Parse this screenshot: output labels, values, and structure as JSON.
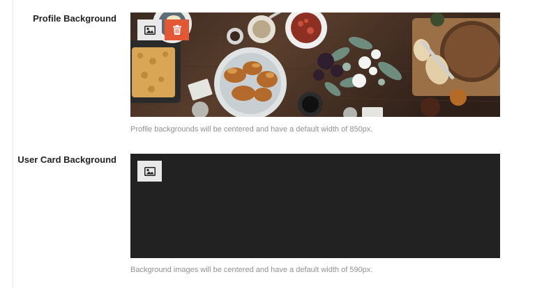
{
  "profile_background": {
    "label": "Profile Background",
    "help_text": "Profile backgrounds will be centered and have a default width of 850px.",
    "upload_icon": "image-icon",
    "delete_icon": "trash-icon"
  },
  "user_card_background": {
    "label": "User Card Background",
    "help_text": "Background images will be centered and have a default width of 590px.",
    "upload_icon": "image-icon"
  },
  "colors": {
    "delete_button": "#e45735",
    "upload_button": "#e9e9e9",
    "card_placeholder": "#222222",
    "help_text": "#919191"
  }
}
